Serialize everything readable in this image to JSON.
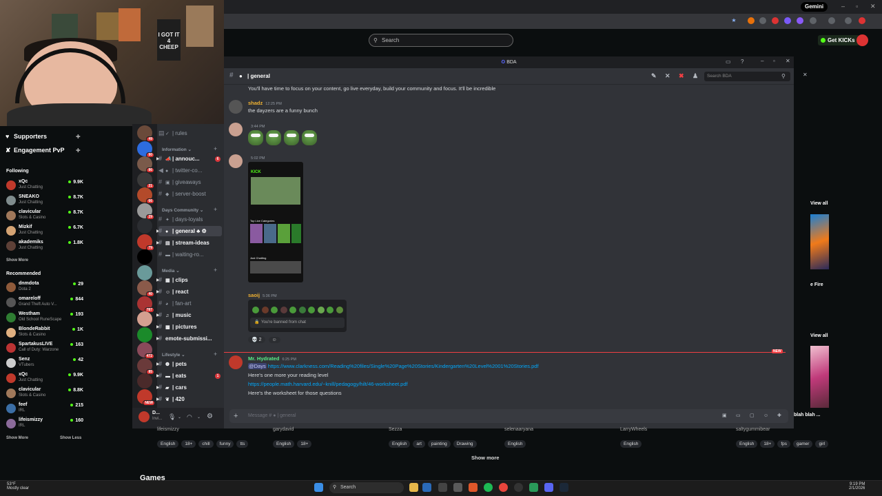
{
  "browser": {
    "gemini_label": "Gemini",
    "window_controls": [
      "–",
      "▫",
      "✕"
    ]
  },
  "kick": {
    "search_placeholder": "Search",
    "get_kicks_label": "Get KICKs",
    "sidebar": {
      "top_items": [
        {
          "label": "Supporters"
        },
        {
          "label": "Engagement PvP"
        }
      ],
      "following_header": "Following",
      "following": [
        {
          "name": "xQc",
          "category": "Just Chatting",
          "viewers": "9.9K",
          "color": "#c0392b"
        },
        {
          "name": "SNEAKO",
          "category": "Just Chatting",
          "viewers": "8.7K",
          "color": "#7f8c8d"
        },
        {
          "name": "clavicular",
          "category": "Slots & Casino",
          "viewers": "8.7K",
          "color": "#a0785a"
        },
        {
          "name": "Mizkif",
          "category": "Just Chatting",
          "viewers": "6.7K",
          "color": "#d4a373"
        },
        {
          "name": "akademiks",
          "category": "Just Chatting",
          "viewers": "1.8K",
          "color": "#5d4037"
        }
      ],
      "show_more_1": "Show More",
      "recommended_header": "Recommended",
      "recommended": [
        {
          "name": "dnmdota",
          "category": "Dota 2",
          "viewers": "29",
          "color": "#8e5a3a"
        },
        {
          "name": "omareloff",
          "category": "Grand Theft Auto V...",
          "viewers": "844",
          "color": "#555"
        },
        {
          "name": "Westham",
          "category": "Old School RuneScape",
          "viewers": "193",
          "color": "#2e7d32"
        },
        {
          "name": "BlondeRabbit",
          "category": "Slots & Casino",
          "viewers": "1K",
          "color": "#e0b080"
        },
        {
          "name": "SpartakusLIVE",
          "category": "Call of Duty: Warzone",
          "viewers": "163",
          "color": "#b33"
        },
        {
          "name": "Senz",
          "category": "VTubers",
          "viewers": "42",
          "color": "#ccc"
        },
        {
          "name": "xQc",
          "category": "Just Chatting",
          "viewers": "9.9K",
          "color": "#c0392b"
        },
        {
          "name": "clavicular",
          "category": "Slots & Casino",
          "viewers": "8.8K",
          "color": "#a0785a"
        },
        {
          "name": "feef",
          "category": "IRL",
          "viewers": "215",
          "color": "#3b6ea5"
        },
        {
          "name": "lifeismizzy",
          "category": "IRL",
          "viewers": "160",
          "color": "#8a6a9a"
        }
      ],
      "show_more_2": "Show More",
      "show_less": "Show Less"
    },
    "right": {
      "view_all_1": "View all",
      "fire_label": "e Fire",
      "view_all_2": "View all",
      "blah_label": "blah blah ..."
    },
    "bottom_tiles": [
      {
        "name": "lifeismizzy",
        "tags": [
          "English",
          "18+",
          "chill",
          "funny",
          "tts"
        ]
      },
      {
        "name": "garydavid",
        "tags": [
          "English",
          "18+"
        ]
      },
      {
        "name": "Sezza",
        "tags": [
          "English",
          "art",
          "painting",
          "Drawing"
        ]
      },
      {
        "name": "selenaaryana",
        "tags": [
          "English"
        ]
      },
      {
        "name": "LarryWheels",
        "tags": [
          "English"
        ]
      },
      {
        "name": "saltygummibear",
        "tags": [
          "English",
          "18+",
          "fps",
          "gamer",
          "girl"
        ]
      }
    ],
    "show_more_label": "Show more",
    "games_label": "Games"
  },
  "webcam": {
    "poster_text": "I GOT IT 4 CHEEP"
  },
  "discord": {
    "window_title": "BDA",
    "channel_name": "| general",
    "search_placeholder": "Search BDA",
    "categories": {
      "information": "Information",
      "days_community": "Days Community",
      "media": "Media",
      "lifestyle": "Lifestyle"
    },
    "channels": {
      "rules": "| rules",
      "annou": "| annouc...",
      "twitter": "| twitter-co...",
      "giveaways": "| giveaways",
      "server_boost": "| server-boost",
      "days_loyals": "| days-loyals",
      "general": "| general",
      "stream_ideas": "| stream-ideas",
      "waiting": "| waiting-ro...",
      "clips": "| clips",
      "react": "| react",
      "fan_art": "| fan-art",
      "music": "| music",
      "pictures": "| pictures",
      "emote": "emote-submissi...",
      "pets": "| pets",
      "eats": "| eats",
      "cars": "| cars",
      "420": "| 420"
    },
    "annou_ping": "6",
    "eats_ping": "1",
    "servers": [
      {
        "color": "#6a4a3a",
        "badge": "49"
      },
      {
        "color": "#2d6cdf",
        "badge": "90"
      },
      {
        "color": "#7a5a4a",
        "badge": "86"
      },
      {
        "color": "#3a3a3a",
        "badge": "21"
      },
      {
        "color": "#b34a2a",
        "badge": "66"
      },
      {
        "color": "#9a9a9a",
        "badge": "29"
      },
      {
        "color": "#2b2d31",
        "badge": ""
      },
      {
        "color": "#c0392b",
        "badge": "79"
      },
      {
        "color": "#000000",
        "badge": ""
      },
      {
        "color": "#6a9a9a",
        "badge": ""
      },
      {
        "color": "#8a5a4a",
        "badge": "40"
      },
      {
        "color": "#a33",
        "badge": "787"
      },
      {
        "color": "#d4a090",
        "badge": ""
      },
      {
        "color": "#1b8a2a",
        "badge": ""
      },
      {
        "color": "#8a4a5a",
        "badge": "472"
      },
      {
        "color": "#6a3a3a",
        "badge": "85"
      },
      {
        "color": "#4a2a2a",
        "badge": ""
      },
      {
        "color": "#c0392b",
        "badge": "NEW"
      }
    ],
    "user_panel_name": "D...",
    "user_panel_status": "Invi...",
    "top_message": "You'll have time to focus on your content, go live everyday, build your community and focus. It'll be incredible",
    "messages": [
      {
        "author": "shadz",
        "time": "12:25 PM",
        "text": "the dayzers are a funny bunch",
        "color": "#f0b232"
      },
      {
        "author": "",
        "time": "3:44 PM",
        "color": "#5865f2"
      },
      {
        "author": "",
        "time": "5:02 PM",
        "color": "#5865f2"
      },
      {
        "author": "saoij",
        "time": "5:36 PM",
        "color": "#f0b232"
      },
      {
        "author": "Mr. Hydrated",
        "time": "6:25 PM",
        "color": "#57f287"
      }
    ],
    "ban_text": "You're banned from chat",
    "reaction_count": "2",
    "hydrated": {
      "mention": "@Days",
      "link1": "https://www.clarkness.com/Reading%20files/Single%20Page%20Stories/Kindergarten%20Level%2001%20Stories.pdf",
      "line2": "Here's one more your reading level",
      "link2": "https://people.math.harvard.edu/~knill/pedagogy/hilt/46-worksheet.pdf",
      "line4": "Here's the worksheet for those questions"
    },
    "composer_placeholder": "Message #",
    "composer_channel": "| general",
    "new_tag": "NEW"
  },
  "screenshot": {
    "kick_logo": "KICK",
    "top_live": "Top Live Categories",
    "just_chatting": "Just Chatting"
  },
  "taskbar": {
    "temp": "53°F",
    "weather": "Mostly clear",
    "search": "Search",
    "time": "9:19 PM",
    "date": "2/1/2026"
  }
}
